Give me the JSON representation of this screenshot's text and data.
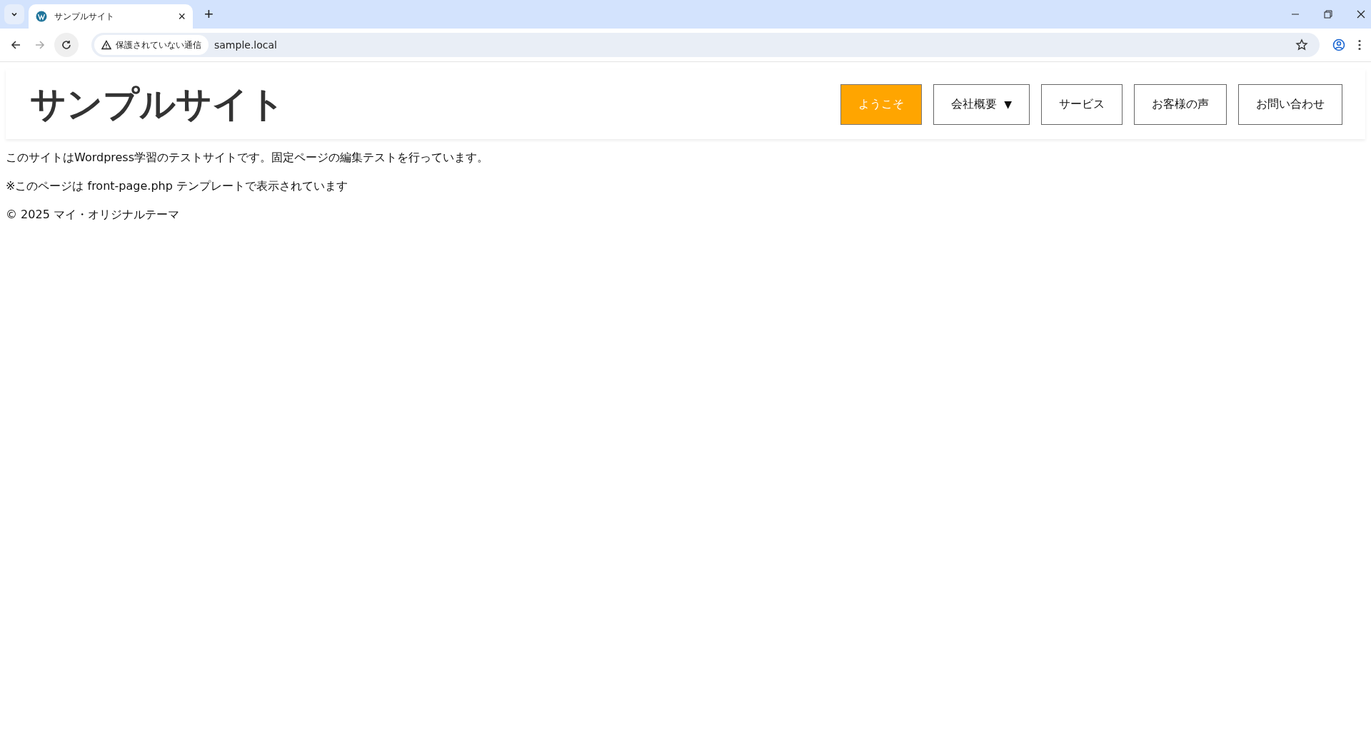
{
  "browser": {
    "tab": {
      "title": "サンプルサイト",
      "close": "×"
    },
    "new_tab": "+",
    "security_label": "保護されていない通信",
    "url": "sample.local"
  },
  "site": {
    "title": "サンプルサイト",
    "nav": [
      {
        "label": "ようこそ",
        "selected": true
      },
      {
        "label": "会社概要",
        "selected": false,
        "caret": "▼"
      },
      {
        "label": "サービス",
        "selected": false
      },
      {
        "label": "お客様の声",
        "selected": false
      },
      {
        "label": "お問い合わせ",
        "selected": false
      }
    ]
  },
  "paragraphs": [
    "このサイトはWordpress学習のテストサイトです。固定ページの編集テストを行っています。",
    "※このページは front-page.php テンプレートで表示されています"
  ],
  "footer": "© 2025 マイ・オリジナルテーマ"
}
